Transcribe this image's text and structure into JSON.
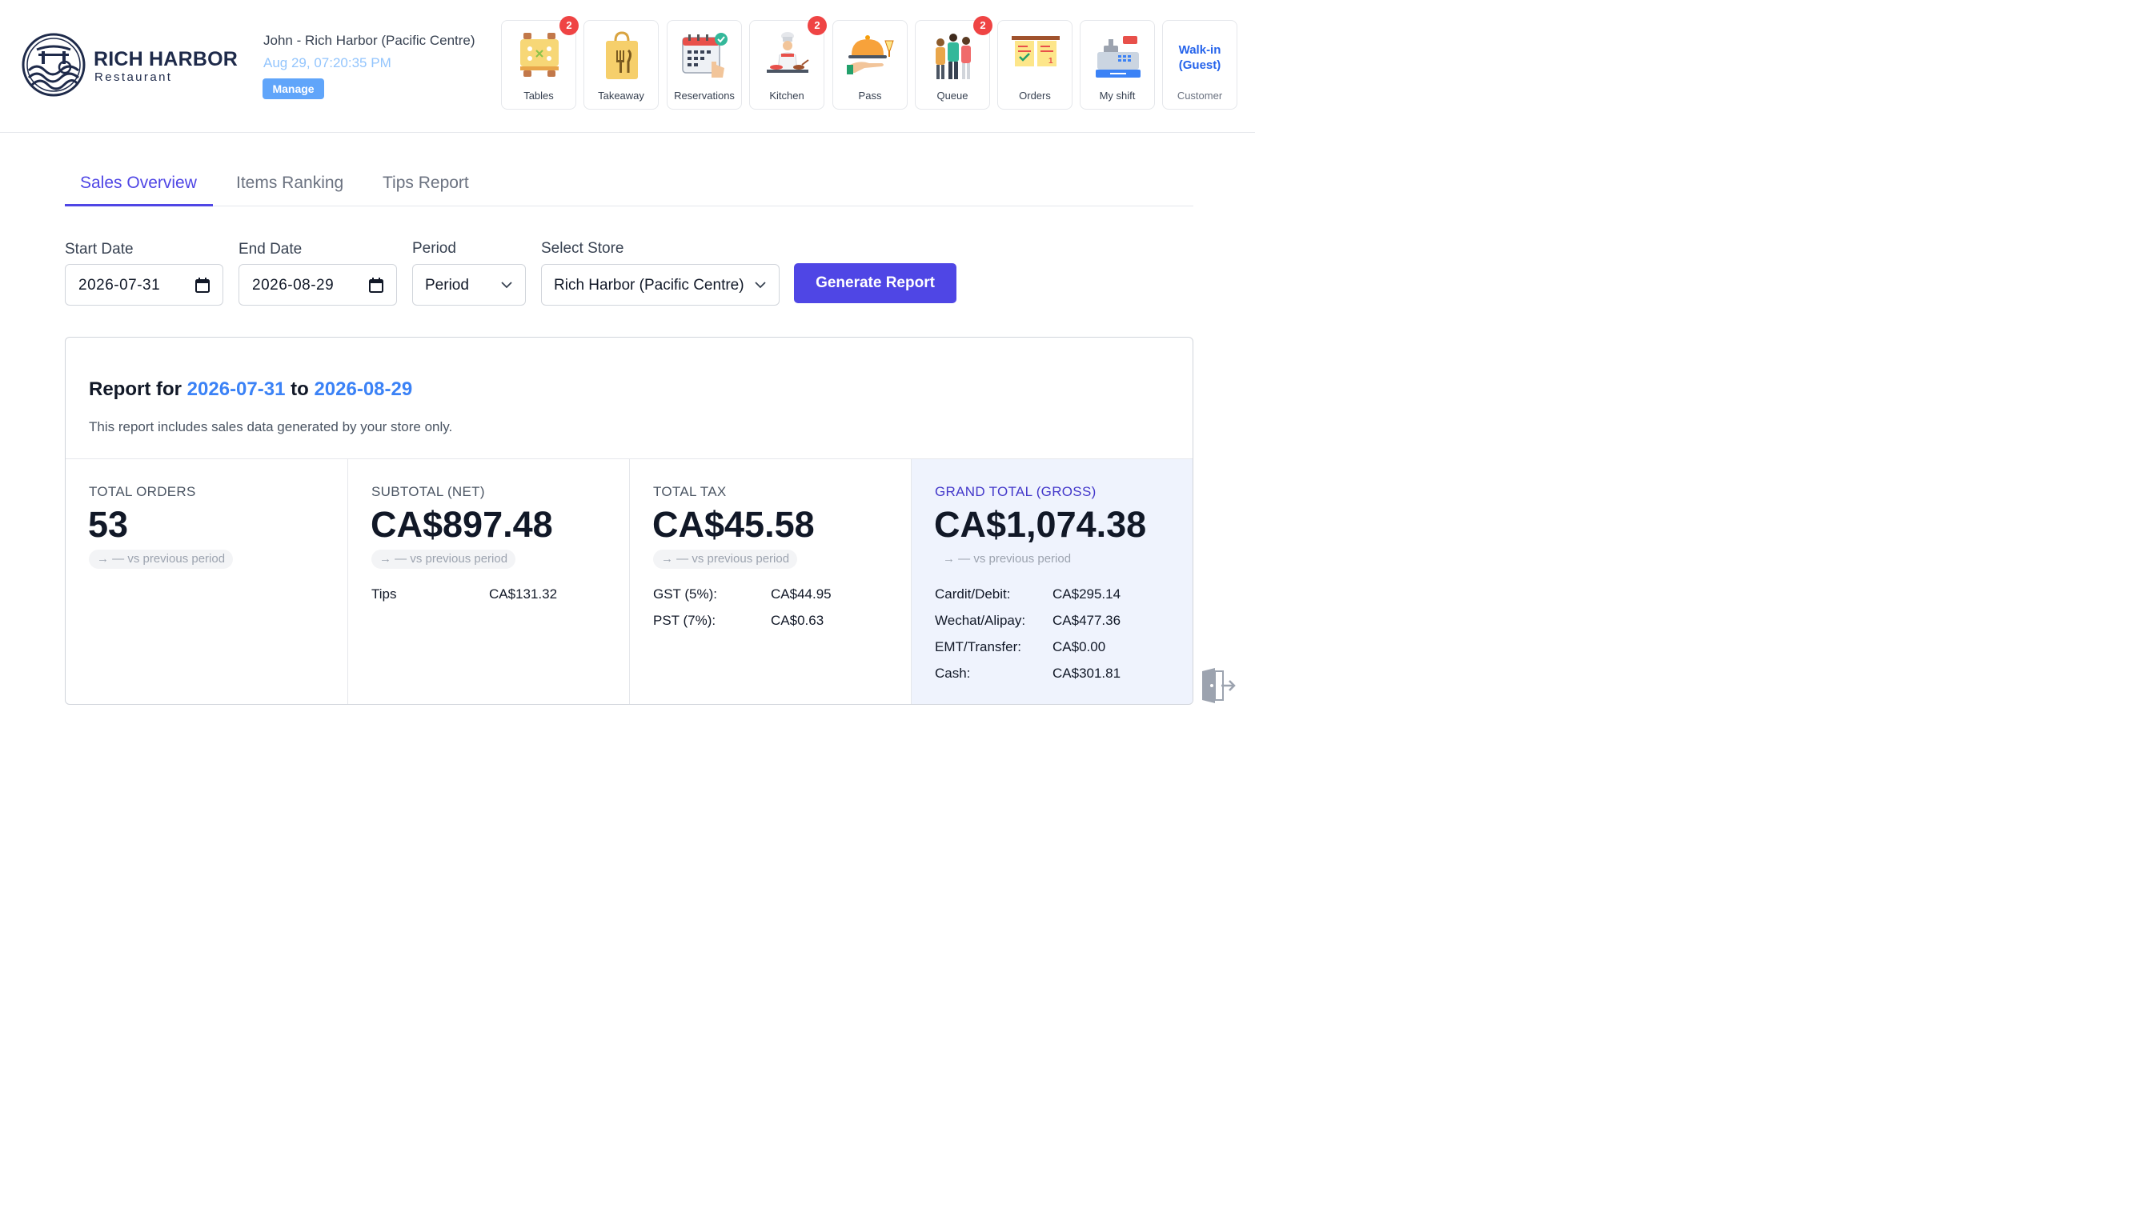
{
  "brand": {
    "name": "RICH HARBOR",
    "subtitle": "Restaurant"
  },
  "user": {
    "name_line": "John - Rich Harbor (Pacific Centre)",
    "datetime": "Aug 29, 07:20:35 PM",
    "manage_label": "Manage"
  },
  "nav": [
    {
      "label": "Tables",
      "icon": "tables-icon",
      "badge": "2"
    },
    {
      "label": "Takeaway",
      "icon": "takeaway-bag-icon"
    },
    {
      "label": "Reservations",
      "icon": "calendar-check-icon"
    },
    {
      "label": "Kitchen",
      "icon": "chef-icon",
      "badge": "2"
    },
    {
      "label": "Pass",
      "icon": "serving-cloche-icon"
    },
    {
      "label": "Queue",
      "icon": "people-queue-icon",
      "badge": "2"
    },
    {
      "label": "Orders",
      "icon": "order-notes-icon"
    },
    {
      "label": "My shift",
      "icon": "cash-register-icon"
    }
  ],
  "customer": {
    "title": "Walk-in\n(Guest)",
    "label": "Customer"
  },
  "tabs": [
    {
      "label": "Sales Overview",
      "active": true
    },
    {
      "label": "Items Ranking",
      "active": false
    },
    {
      "label": "Tips Report",
      "active": false
    }
  ],
  "filters": {
    "start_label": "Start Date",
    "start_value": "2026-07-31",
    "end_label": "End Date",
    "end_value": "2026-08-29",
    "period_label": "Period",
    "period_value": "Period",
    "store_label": "Select Store",
    "store_value": "Rich Harbor (Pacific Centre)",
    "generate_label": "Generate Report"
  },
  "report": {
    "title_prefix": "Report for",
    "start": "2026-07-31",
    "title_mid": "to",
    "end": "2026-08-29",
    "note": "This report includes sales data generated by your store only.",
    "comparison": "→ — vs previous period",
    "total_orders": {
      "label": "TOTAL ORDERS",
      "value": "53"
    },
    "subtotal": {
      "label": "SUBTOTAL (NET)",
      "value": "CA$897.48",
      "tips_label": "Tips",
      "tips_value": "CA$131.32"
    },
    "tax": {
      "label": "TOTAL TAX",
      "value": "CA$45.58",
      "gst_label": "GST (5%):",
      "gst_value": "CA$44.95",
      "pst_label": "PST (7%):",
      "pst_value": "CA$0.63"
    },
    "gross": {
      "label": "GRAND TOTAL (GROSS)",
      "value": "CA$1,074.38",
      "card_label": "Cardit/Debit:",
      "card_value": "CA$295.14",
      "wechat_label": "Wechat/Alipay:",
      "wechat_value": "CA$477.36",
      "emt_label": "EMT/Transfer:",
      "emt_value": "CA$0.00",
      "cash_label": "Cash:",
      "cash_value": "CA$301.81"
    }
  },
  "colors": {
    "accent": "#4f46e5",
    "link_blue": "#3b82f6",
    "badge_red": "#ef4444",
    "gross_bg": "#eff3fd"
  }
}
